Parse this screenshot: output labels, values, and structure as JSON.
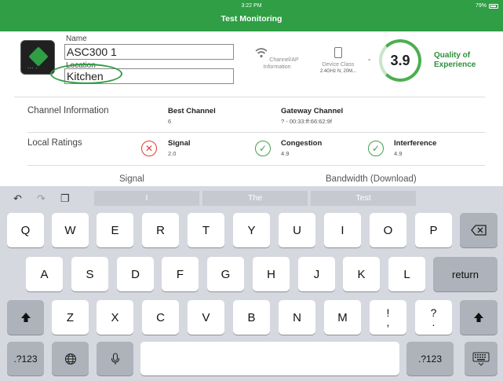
{
  "status_bar": {
    "time": "3:22 PM",
    "title": "Test Monitoring",
    "battery": "79%"
  },
  "device": {
    "name_label": "Name",
    "name_value": "ASC300 1",
    "location_label": "Location",
    "location_value": "Kitchen",
    "channel_ap_label": "Channel/AP Information",
    "device_class_label": "Device Class",
    "device_class_value": "2.4GHz N, 20M...",
    "qoe_score": "3.9",
    "qoe_label": "Quality of Experience"
  },
  "channel_info": {
    "label": "Channel Information",
    "best_channel_title": "Best Channel",
    "best_channel_value": "6",
    "gateway_channel_title": "Gateway Channel",
    "gateway_channel_value": "? - 00:33:ff:66:62:9f"
  },
  "local_ratings": {
    "label": "Local Ratings",
    "signal_title": "Signal",
    "signal_value": "2.0",
    "congestion_title": "Congestion",
    "congestion_value": "4.9",
    "interference_title": "Interference",
    "interference_value": "4.9",
    "colors": {
      "bad": "#e53935",
      "good": "#43a047"
    }
  },
  "sections": {
    "signal": "Signal",
    "bandwidth": "Bandwidth (Download)"
  },
  "keyboard": {
    "suggestions": [
      "I",
      "The",
      "Test"
    ],
    "row1": [
      "Q",
      "W",
      "E",
      "R",
      "T",
      "Y",
      "U",
      "I",
      "O",
      "P"
    ],
    "row2": [
      "A",
      "S",
      "D",
      "F",
      "G",
      "H",
      "J",
      "K",
      "L"
    ],
    "row3": [
      "Z",
      "X",
      "C",
      "V",
      "B",
      "N",
      "M"
    ],
    "row3_punct": [
      [
        "!",
        ","
      ],
      [
        "?",
        "."
      ]
    ],
    "return_label": "return",
    "numbers_label": ".?123"
  },
  "accent_color": "#2f9e44"
}
